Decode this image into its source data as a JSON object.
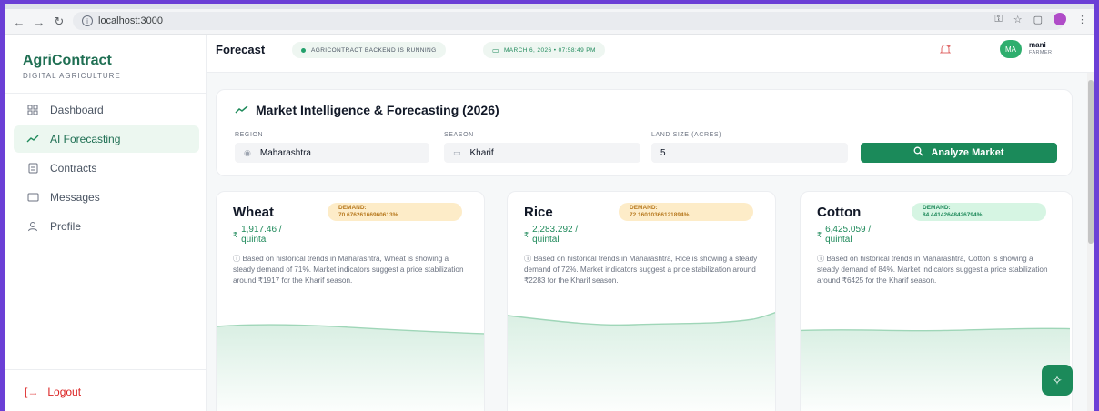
{
  "browser": {
    "url": "localhost:3000"
  },
  "sidebar": {
    "brand": "AgriContract",
    "tagline": "DIGITAL AGRICULTURE",
    "items": [
      {
        "label": "Dashboard",
        "icon": "grid-icon"
      },
      {
        "label": "AI Forecasting",
        "icon": "trend-up-icon"
      },
      {
        "label": "Contracts",
        "icon": "file-icon"
      },
      {
        "label": "Messages",
        "icon": "message-icon"
      },
      {
        "label": "Profile",
        "icon": "user-icon"
      }
    ],
    "logout": "Logout"
  },
  "header": {
    "title": "Forecast",
    "status": "AGRICONTRACT BACKEND IS RUNNING",
    "datetime": "MARCH 6, 2026 • 07:58:49 PM",
    "user": {
      "initials": "MA",
      "name": "mani",
      "role": "FARMER"
    }
  },
  "forecast": {
    "title": "Market Intelligence & Forecasting (2026)",
    "region_label": "REGION",
    "region_value": "Maharashtra",
    "season_label": "SEASON",
    "season_value": "Kharif",
    "land_label": "LAND SIZE (ACRES)",
    "land_value": "5",
    "analyze_label": "Analyze Market"
  },
  "cards": [
    {
      "crop": "Wheat",
      "demand_label": "DEMAND:",
      "demand_value": "70.67626166960613%",
      "currency": "₹",
      "price": "1,917.46 /",
      "unit": "quintal",
      "description": "Based on historical trends in Maharashtra, Wheat is showing a steady demand of 71%. Market indicators suggest a price stabilization around ₹1917 for the Kharif season.",
      "demand_color": "#fdecc8"
    },
    {
      "crop": "Rice",
      "demand_label": "DEMAND:",
      "demand_value": "72.16010366121894%",
      "currency": "₹",
      "price": "2,283.292 /",
      "unit": "quintal",
      "description": "Based on historical trends in Maharashtra, Rice is showing a steady demand of 72%. Market indicators suggest a price stabilization around ₹2283 for the Kharif season.",
      "demand_color": "#fdecc8"
    },
    {
      "crop": "Cotton",
      "demand_label": "DEMAND:",
      "demand_value": "84.44142648426794%",
      "currency": "₹",
      "price": "6,425.059 /",
      "unit": "quintal",
      "description": "Based on historical trends in Maharashtra, Cotton is showing a steady demand of 84%. Market indicators suggest a price stabilization around ₹6425 for the Kharif season.",
      "demand_color": "#d6f5e3"
    }
  ],
  "colors": {
    "accent": "#1b8a5a",
    "brand": "#1f6f53",
    "logout": "#dc2626",
    "frame": "#6b3fd6"
  }
}
